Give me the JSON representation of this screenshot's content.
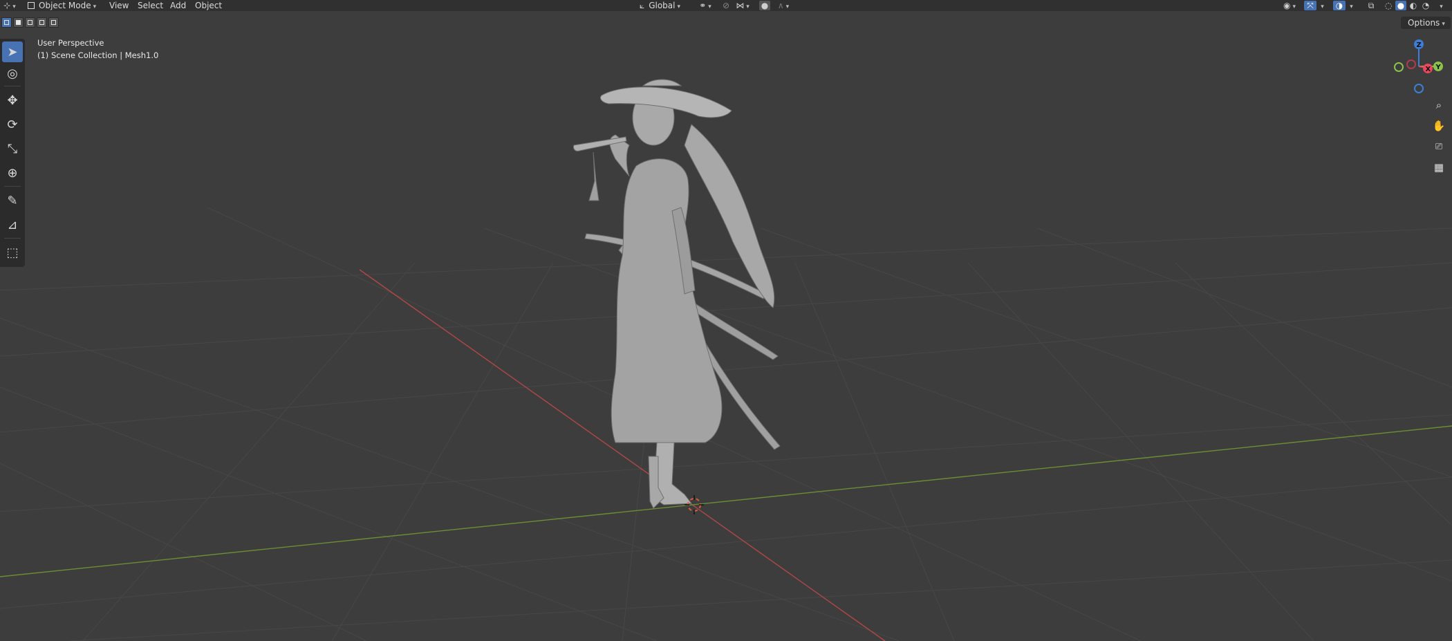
{
  "header": {
    "mode_label": "Object Mode",
    "menus": [
      {
        "label": "View"
      },
      {
        "label": "Select"
      },
      {
        "label": "Add"
      },
      {
        "label": "Object"
      }
    ],
    "transform_orientation": "Global",
    "icons": {
      "editor_type": "editor-type-icon",
      "mode": "object-mode-icon",
      "orientation": "transform-orientation-icon",
      "pivot": "pivot-point-icon",
      "snap": "snap-icon",
      "proportional": "proportional-editing-icon",
      "visibility": "visibility-icon",
      "gizmo": "gizmo-toggle-icon",
      "overlay": "overlay-icon",
      "xray": "xray-icon",
      "shading": [
        "wireframe-shading-icon",
        "solid-shading-icon",
        "material-shading-icon",
        "rendered-shading-icon"
      ]
    }
  },
  "selection_modes": [
    "select-new-icon",
    "select-extend-icon",
    "select-subtract-icon",
    "select-difference-icon",
    "select-intersect-icon"
  ],
  "toolbar": {
    "tools": [
      {
        "name": "select-box",
        "icon": "cursor-select-icon",
        "glyph": "➤",
        "active": true
      },
      {
        "name": "cursor",
        "icon": "3d-cursor-icon",
        "glyph": "◎",
        "active": false
      },
      {
        "name": "move",
        "icon": "move-icon",
        "glyph": "✥",
        "active": false
      },
      {
        "name": "rotate",
        "icon": "rotate-icon",
        "glyph": "⟳",
        "active": false
      },
      {
        "name": "scale",
        "icon": "scale-icon",
        "glyph": "⤡",
        "active": false
      },
      {
        "name": "transform",
        "icon": "transform-icon",
        "glyph": "⊕",
        "active": false
      },
      {
        "name": "annotate",
        "icon": "annotate-icon",
        "glyph": "✎",
        "active": false
      },
      {
        "name": "measure",
        "icon": "measure-icon",
        "glyph": "📐",
        "active": false
      },
      {
        "name": "add-cube",
        "icon": "add-cube-icon",
        "glyph": "⬚",
        "active": false
      }
    ]
  },
  "viewport": {
    "view_name": "User Perspective",
    "collection_info": "(1) Scene Collection | Mesh1.0"
  },
  "right_panel": {
    "options_label": "Options",
    "gizmo_axes": {
      "z": "Z",
      "y": "Y",
      "x": "X"
    },
    "nav_buttons": [
      {
        "name": "zoom-button",
        "icon": "zoom-icon",
        "glyph": "⌕"
      },
      {
        "name": "pan-button",
        "icon": "hand-pan-icon",
        "glyph": "✋"
      },
      {
        "name": "camera-view-button",
        "icon": "camera-icon",
        "glyph": "🎥"
      },
      {
        "name": "ortho-toggle-button",
        "icon": "grid-perspective-icon",
        "glyph": "▦"
      }
    ]
  },
  "colors": {
    "axis_x": "#c85050",
    "axis_y": "#7a9a3a",
    "accent": "#4772b3",
    "gizmo_x": "#e8495e",
    "gizmo_y": "#8bc34a",
    "gizmo_z": "#3d7fd6"
  }
}
